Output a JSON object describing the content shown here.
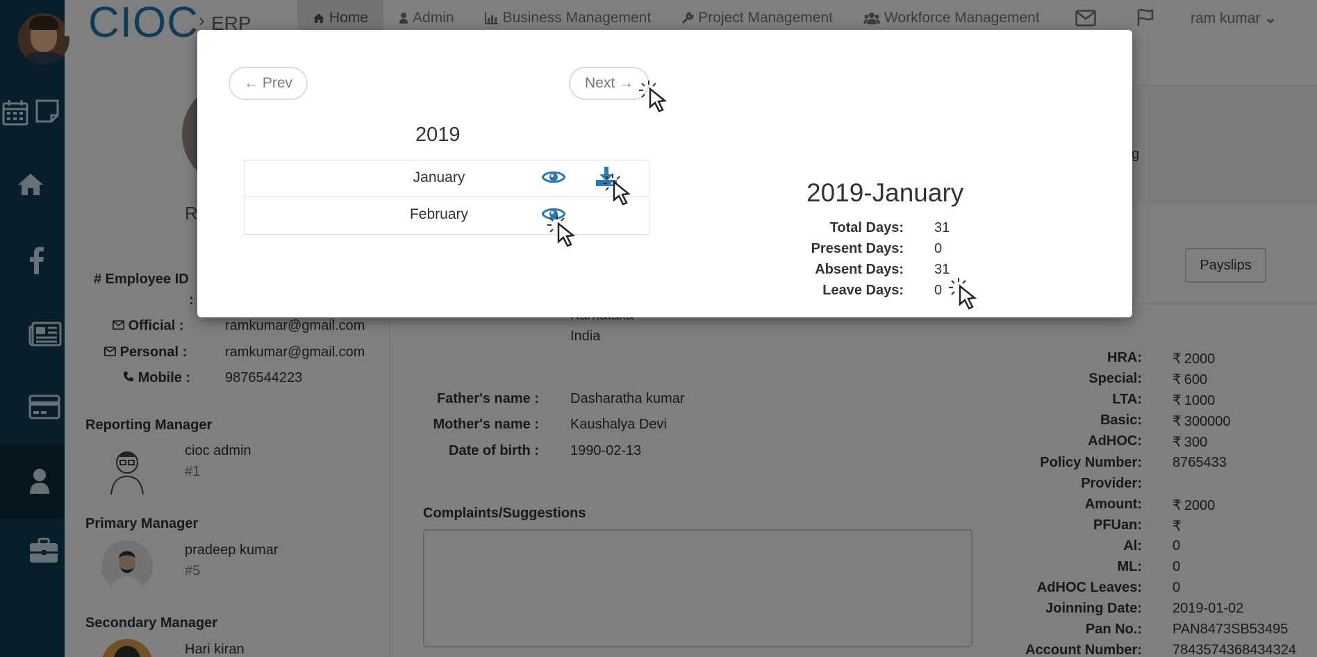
{
  "app": {
    "brand": "CIOC",
    "brand_sub": "ERP",
    "nav": [
      {
        "label": "Home",
        "icon": "home-icon"
      },
      {
        "label": "Admin",
        "icon": "user-icon"
      },
      {
        "label": "Business Management",
        "icon": "bar-chart-icon"
      },
      {
        "label": "Project Management",
        "icon": "wrench-icon"
      },
      {
        "label": "Workforce Management",
        "icon": "users-icon"
      }
    ],
    "user_name": "ram kumar"
  },
  "profile": {
    "name_initial": "R",
    "employee_id_label": "# Employee ID",
    "employee_id_colon": ":",
    "official_label": "Official :",
    "official_value": "ramkumar@gmail.com",
    "personal_label": "Personal :",
    "personal_value": "ramkumar@gmail.com",
    "mobile_label": "Mobile :",
    "mobile_value": "9876544223",
    "reporting_manager_title": "Reporting Manager",
    "reporting_manager": {
      "name": "cioc admin",
      "id": "#1"
    },
    "primary_manager_title": "Primary Manager",
    "primary_manager": {
      "name": "pradeep kumar",
      "id": "#5"
    },
    "secondary_manager_title": "Secondary Manager",
    "secondary_manager": {
      "name": "Hari kiran"
    }
  },
  "middle": {
    "address_partial": "Karnataka",
    "country": "India",
    "father_label": "Father's name :",
    "father_value": "Dasharatha kumar",
    "mother_label": "Mother's name :",
    "mother_value": "Kaushalya Devi",
    "dob_label": "Date of birth :",
    "dob_value": "1990-02-13",
    "complaints_title": "Complaints/Suggestions"
  },
  "right": {
    "partial_text": "ng",
    "tab_partial": "ils",
    "payslips_button": "Payslips",
    "currency_symbol": "₹",
    "details": [
      {
        "label": "HRA:",
        "value": "2000",
        "currency": true
      },
      {
        "label": "Special:",
        "value": "600",
        "currency": true
      },
      {
        "label": "LTA:",
        "value": "1000",
        "currency": true
      },
      {
        "label": "Basic:",
        "value": "300000",
        "currency": true
      },
      {
        "label": "AdHOC:",
        "value": "300",
        "currency": true
      },
      {
        "label": "Policy Number:",
        "value": "8765433",
        "currency": false
      },
      {
        "label": "Provider:",
        "value": "",
        "currency": false
      },
      {
        "label": "Amount:",
        "value": "2000",
        "currency": true
      },
      {
        "label": "PFUan:",
        "value": "",
        "currency": true
      },
      {
        "label": "Al:",
        "value": "0",
        "currency": false
      },
      {
        "label": "ML:",
        "value": "0",
        "currency": false
      },
      {
        "label": "AdHOC Leaves:",
        "value": "0",
        "currency": false
      },
      {
        "label": "Joinning Date:",
        "value": "2019-01-02",
        "currency": false
      },
      {
        "label": "Pan No.:",
        "value": "PAN8473SB53495",
        "currency": false
      },
      {
        "label": "Account Number:",
        "value": "7843574368434324",
        "currency": false
      }
    ]
  },
  "modal": {
    "prev_label": "← Prev",
    "next_label": "Next →",
    "year": "2019",
    "months": [
      "January",
      "February"
    ],
    "summary_title": "2019-January",
    "summary": [
      {
        "label": "Total Days:",
        "value": "31"
      },
      {
        "label": "Present Days:",
        "value": "0"
      },
      {
        "label": "Absent Days:",
        "value": "31"
      },
      {
        "label": "Leave Days:",
        "value": "0"
      }
    ]
  },
  "colors": {
    "sidebar": "#0d3e54",
    "brand": "#1f7bb0",
    "action_icon": "#2a7ab8"
  }
}
